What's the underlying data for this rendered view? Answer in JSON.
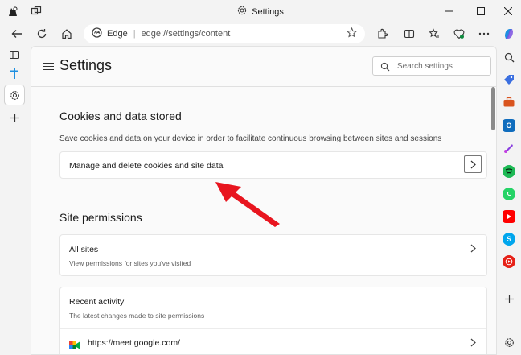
{
  "window": {
    "title": "Settings"
  },
  "toolbar": {
    "address_label": "Edge",
    "address_url": "edge://settings/content"
  },
  "header": {
    "title": "Settings",
    "search_placeholder": "Search settings"
  },
  "cookies": {
    "title": "Cookies and data stored",
    "description": "Save cookies and data on your device in order to facilitate continuous browsing between sites and sessions",
    "manage_label": "Manage and delete cookies and site data"
  },
  "permissions": {
    "title": "Site permissions",
    "all_sites_title": "All sites",
    "all_sites_sub": "View permissions for sites you've visited",
    "recent_title": "Recent activity",
    "recent_sub": "The latest changes made to site permissions",
    "recent_site": "https://meet.google.com/"
  },
  "colors": {
    "annotation_arrow": "#e8151f",
    "accent": "#0f6cbd"
  }
}
